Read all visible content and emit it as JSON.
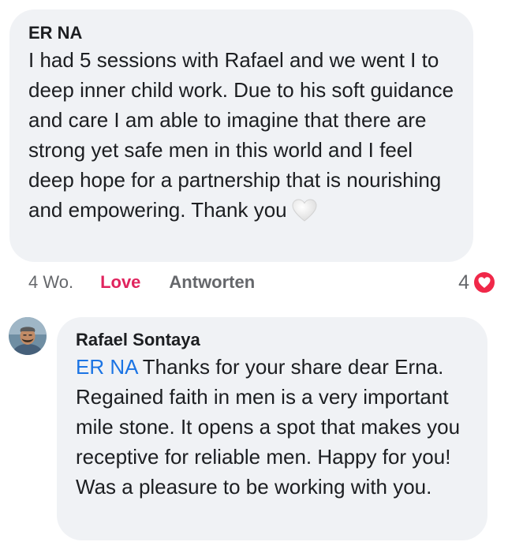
{
  "comment": {
    "author": "ER NA",
    "text": "I had 5 sessions with Rafael and we went I to deep inner child work. Due to his soft guidance and care I am able to imagine that there are strong yet safe men in this world and I feel deep hope for a partnership that is nourishing and empowering. Thank you",
    "emoji": "white-heart-icon",
    "time": "4 Wo.",
    "reaction_label": "Love",
    "reply_label": "Antworten",
    "reaction_count": "4",
    "reaction_icon": "heart-reaction-icon",
    "reaction_color": "#e0245e"
  },
  "reply": {
    "author": "Rafael Sontaya",
    "mention": "ER NA",
    "text": " Thanks for your share dear Erna. Regained faith in men is a very important mile stone. It opens a spot that makes you receptive for reliable men. Happy for you! Was a pleasure to be working with you.",
    "mention_color": "#1b74e4",
    "avatar": "avatar"
  }
}
